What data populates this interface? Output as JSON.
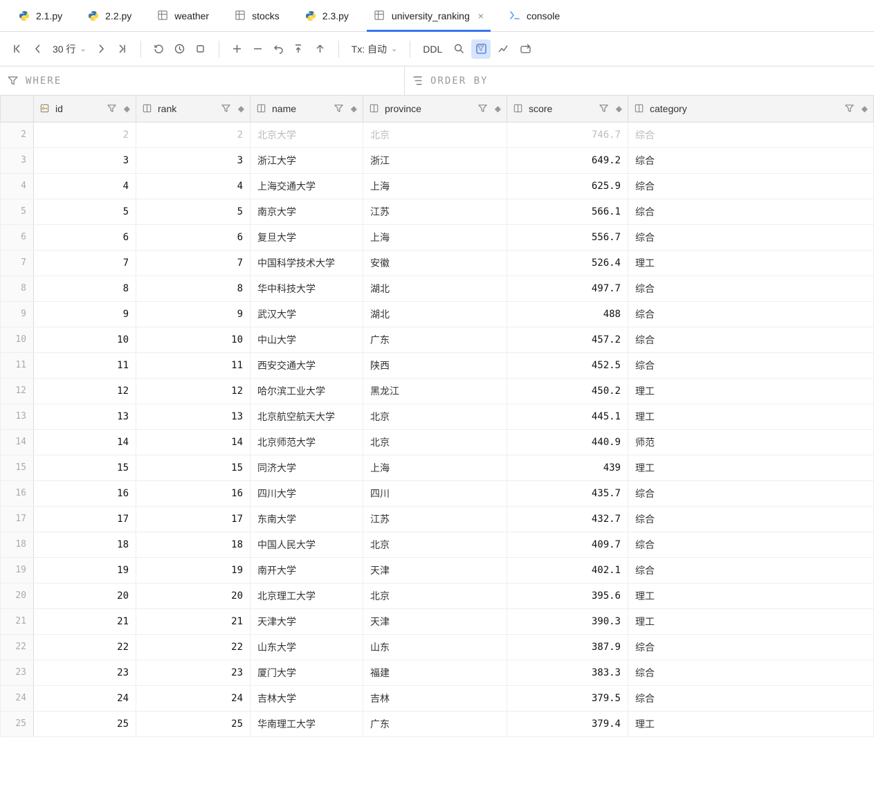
{
  "tabs": [
    {
      "label": "2.1.py",
      "icon": "python"
    },
    {
      "label": "2.2.py",
      "icon": "python"
    },
    {
      "label": "weather",
      "icon": "grid"
    },
    {
      "label": "stocks",
      "icon": "grid"
    },
    {
      "label": "2.3.py",
      "icon": "python"
    },
    {
      "label": "university_ranking",
      "icon": "grid",
      "active": true,
      "closable": true
    },
    {
      "label": "console",
      "icon": "console"
    }
  ],
  "toolbar": {
    "rows_label": "30 行",
    "tx_label": "Tx: 自动",
    "ddl_label": "DDL"
  },
  "filters": {
    "where_label": "WHERE",
    "orderby_label": "ORDER BY"
  },
  "columns": [
    {
      "key": "id",
      "label": "id",
      "icon": "key"
    },
    {
      "key": "rank",
      "label": "rank",
      "icon": "col"
    },
    {
      "key": "name",
      "label": "name",
      "icon": "col"
    },
    {
      "key": "province",
      "label": "province",
      "icon": "col"
    },
    {
      "key": "score",
      "label": "score",
      "icon": "col"
    },
    {
      "key": "category",
      "label": "category",
      "icon": "col"
    }
  ],
  "rows": [
    {
      "n": 2,
      "id": 2,
      "rank": 2,
      "name": "北京大学",
      "province": "北京",
      "score": "746.7",
      "category": "综合",
      "faded": true
    },
    {
      "n": 3,
      "id": 3,
      "rank": 3,
      "name": "浙江大学",
      "province": "浙江",
      "score": "649.2",
      "category": "综合"
    },
    {
      "n": 4,
      "id": 4,
      "rank": 4,
      "name": "上海交通大学",
      "province": "上海",
      "score": "625.9",
      "category": "综合"
    },
    {
      "n": 5,
      "id": 5,
      "rank": 5,
      "name": "南京大学",
      "province": "江苏",
      "score": "566.1",
      "category": "综合"
    },
    {
      "n": 6,
      "id": 6,
      "rank": 6,
      "name": "复旦大学",
      "province": "上海",
      "score": "556.7",
      "category": "综合"
    },
    {
      "n": 7,
      "id": 7,
      "rank": 7,
      "name": "中国科学技术大学",
      "province": "安徽",
      "score": "526.4",
      "category": "理工"
    },
    {
      "n": 8,
      "id": 8,
      "rank": 8,
      "name": "华中科技大学",
      "province": "湖北",
      "score": "497.7",
      "category": "综合"
    },
    {
      "n": 9,
      "id": 9,
      "rank": 9,
      "name": "武汉大学",
      "province": "湖北",
      "score": "488",
      "category": "综合"
    },
    {
      "n": 10,
      "id": 10,
      "rank": 10,
      "name": "中山大学",
      "province": "广东",
      "score": "457.2",
      "category": "综合"
    },
    {
      "n": 11,
      "id": 11,
      "rank": 11,
      "name": "西安交通大学",
      "province": "陕西",
      "score": "452.5",
      "category": "综合"
    },
    {
      "n": 12,
      "id": 12,
      "rank": 12,
      "name": "哈尔滨工业大学",
      "province": "黑龙江",
      "score": "450.2",
      "category": "理工"
    },
    {
      "n": 13,
      "id": 13,
      "rank": 13,
      "name": "北京航空航天大学",
      "province": "北京",
      "score": "445.1",
      "category": "理工"
    },
    {
      "n": 14,
      "id": 14,
      "rank": 14,
      "name": "北京师范大学",
      "province": "北京",
      "score": "440.9",
      "category": "师范"
    },
    {
      "n": 15,
      "id": 15,
      "rank": 15,
      "name": "同济大学",
      "province": "上海",
      "score": "439",
      "category": "理工"
    },
    {
      "n": 16,
      "id": 16,
      "rank": 16,
      "name": "四川大学",
      "province": "四川",
      "score": "435.7",
      "category": "综合"
    },
    {
      "n": 17,
      "id": 17,
      "rank": 17,
      "name": "东南大学",
      "province": "江苏",
      "score": "432.7",
      "category": "综合"
    },
    {
      "n": 18,
      "id": 18,
      "rank": 18,
      "name": "中国人民大学",
      "province": "北京",
      "score": "409.7",
      "category": "综合"
    },
    {
      "n": 19,
      "id": 19,
      "rank": 19,
      "name": "南开大学",
      "province": "天津",
      "score": "402.1",
      "category": "综合"
    },
    {
      "n": 20,
      "id": 20,
      "rank": 20,
      "name": "北京理工大学",
      "province": "北京",
      "score": "395.6",
      "category": "理工"
    },
    {
      "n": 21,
      "id": 21,
      "rank": 21,
      "name": "天津大学",
      "province": "天津",
      "score": "390.3",
      "category": "理工"
    },
    {
      "n": 22,
      "id": 22,
      "rank": 22,
      "name": "山东大学",
      "province": "山东",
      "score": "387.9",
      "category": "综合"
    },
    {
      "n": 23,
      "id": 23,
      "rank": 23,
      "name": "厦门大学",
      "province": "福建",
      "score": "383.3",
      "category": "综合"
    },
    {
      "n": 24,
      "id": 24,
      "rank": 24,
      "name": "吉林大学",
      "province": "吉林",
      "score": "379.5",
      "category": "综合"
    },
    {
      "n": 25,
      "id": 25,
      "rank": 25,
      "name": "华南理工大学",
      "province": "广东",
      "score": "379.4",
      "category": "理工"
    }
  ]
}
